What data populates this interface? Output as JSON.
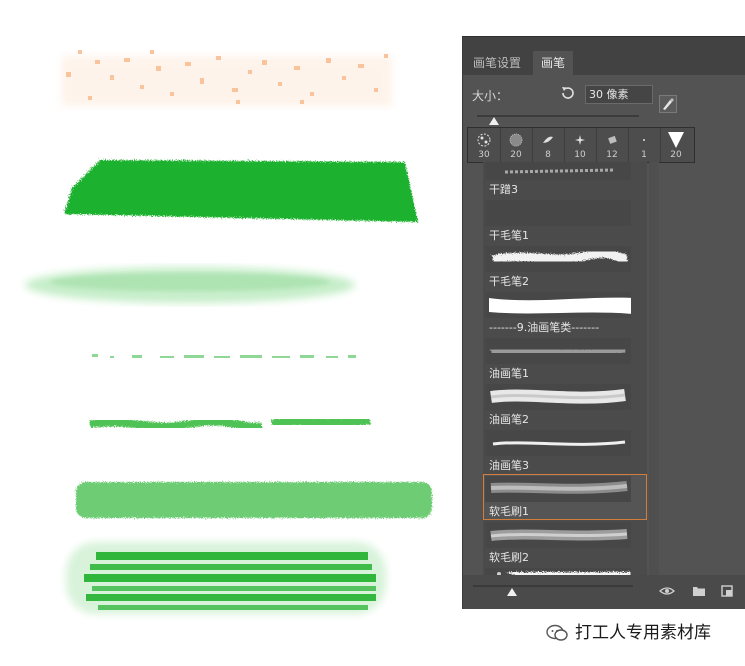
{
  "panel": {
    "tabs": [
      {
        "label": "画笔设置",
        "active": false
      },
      {
        "label": "画笔",
        "active": true
      }
    ],
    "size_label": "大小：",
    "size_value": "30 像素",
    "recent_brushes": [
      {
        "size": "30",
        "icon": "spatter-brush-icon"
      },
      {
        "size": "20",
        "icon": "dotted-brush-icon"
      },
      {
        "size": "8",
        "icon": "leaf-brush-icon"
      },
      {
        "size": "10",
        "icon": "star-brush-icon"
      },
      {
        "size": "12",
        "icon": "rough-brush-icon"
      },
      {
        "size": "1",
        "icon": "tiny-dot-brush-icon"
      },
      {
        "size": "20",
        "icon": "triangle-brush-icon"
      }
    ],
    "brush_list": [
      {
        "label": "干蹭3",
        "preview": "rough-stroke"
      },
      {
        "label": "干毛笔1",
        "preview": "empty"
      },
      {
        "label": "干毛笔2",
        "preview": "dry-brush-white"
      },
      {
        "label": "-------9.油画笔类-------",
        "preview": "solid-white"
      },
      {
        "label": "油画笔1",
        "preview": "oil-gray"
      },
      {
        "label": "油画笔2",
        "preview": "oil-white-thick"
      },
      {
        "label": "油画笔3",
        "preview": "oil-thin"
      },
      {
        "label": "软毛刷1",
        "preview": "soft-gray",
        "selected": true
      },
      {
        "label": "软毛刷2",
        "preview": "soft-gray-2"
      },
      {
        "label": "",
        "preview": "splatter"
      }
    ],
    "bottom_icons": [
      "eye-toggle-icon",
      "folder-icon",
      "new-brush-icon"
    ]
  },
  "colors": {
    "orange_stroke": "#f7b07a",
    "green_solid": "#1eb12d",
    "green_light": "#56c35f",
    "green_pale": "#9fdca4",
    "selection": "#d27d3b"
  },
  "watermark": {
    "text": "打工人专用素材库",
    "icon": "wechat-icon"
  }
}
